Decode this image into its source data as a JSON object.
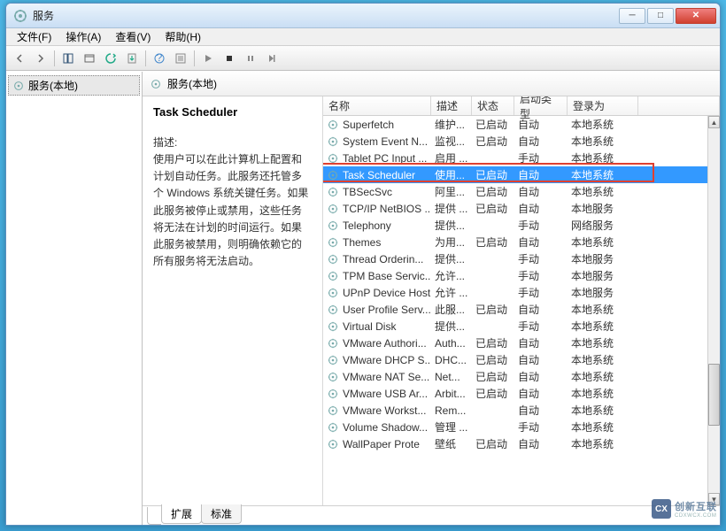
{
  "window": {
    "title": "服务"
  },
  "menu": {
    "file": "文件(F)",
    "action": "操作(A)",
    "view": "查看(V)",
    "help": "帮助(H)"
  },
  "tree": {
    "root": "服务(本地)"
  },
  "right_header": "服务(本地)",
  "detail": {
    "title": "Task Scheduler",
    "desc_label": "描述:",
    "desc": "使用户可以在此计算机上配置和计划自动任务。此服务还托管多个 Windows 系统关键任务。如果此服务被停止或禁用，这些任务将无法在计划的时间运行。如果此服务被禁用，则明确依赖它的所有服务将无法启动。"
  },
  "columns": {
    "name": "名称",
    "desc": "描述",
    "status": "状态",
    "startup": "启动类型",
    "logon": "登录为"
  },
  "services": [
    {
      "name": "Superfetch",
      "desc": "维护...",
      "status": "已启动",
      "startup": "自动",
      "logon": "本地系统"
    },
    {
      "name": "System Event N...",
      "desc": "监视...",
      "status": "已启动",
      "startup": "自动",
      "logon": "本地系统"
    },
    {
      "name": "Tablet PC Input ...",
      "desc": "启用 ...",
      "status": "",
      "startup": "手动",
      "logon": "本地系统"
    },
    {
      "name": "Task Scheduler",
      "desc": "使用...",
      "status": "已启动",
      "startup": "自动",
      "logon": "本地系统",
      "selected": true
    },
    {
      "name": "TBSecSvc",
      "desc": "阿里...",
      "status": "已启动",
      "startup": "自动",
      "logon": "本地系统"
    },
    {
      "name": "TCP/IP NetBIOS ...",
      "desc": "提供 ...",
      "status": "已启动",
      "startup": "自动",
      "logon": "本地服务"
    },
    {
      "name": "Telephony",
      "desc": "提供...",
      "status": "",
      "startup": "手动",
      "logon": "网络服务"
    },
    {
      "name": "Themes",
      "desc": "为用...",
      "status": "已启动",
      "startup": "自动",
      "logon": "本地系统"
    },
    {
      "name": "Thread Orderin...",
      "desc": "提供...",
      "status": "",
      "startup": "手动",
      "logon": "本地服务"
    },
    {
      "name": "TPM Base Servic...",
      "desc": "允许...",
      "status": "",
      "startup": "手动",
      "logon": "本地服务"
    },
    {
      "name": "UPnP Device Host",
      "desc": "允许 ...",
      "status": "",
      "startup": "手动",
      "logon": "本地服务"
    },
    {
      "name": "User Profile Serv...",
      "desc": "此服...",
      "status": "已启动",
      "startup": "自动",
      "logon": "本地系统"
    },
    {
      "name": "Virtual Disk",
      "desc": "提供...",
      "status": "",
      "startup": "手动",
      "logon": "本地系统"
    },
    {
      "name": "VMware Authori...",
      "desc": "Auth...",
      "status": "已启动",
      "startup": "自动",
      "logon": "本地系统"
    },
    {
      "name": "VMware DHCP S...",
      "desc": "DHC...",
      "status": "已启动",
      "startup": "自动",
      "logon": "本地系统"
    },
    {
      "name": "VMware NAT Se...",
      "desc": "Net...",
      "status": "已启动",
      "startup": "自动",
      "logon": "本地系统"
    },
    {
      "name": "VMware USB Ar...",
      "desc": "Arbit...",
      "status": "已启动",
      "startup": "自动",
      "logon": "本地系统"
    },
    {
      "name": "VMware Workst...",
      "desc": "Rem...",
      "status": "",
      "startup": "自动",
      "logon": "本地系统"
    },
    {
      "name": "Volume Shadow...",
      "desc": "管理 ...",
      "status": "",
      "startup": "手动",
      "logon": "本地系统"
    },
    {
      "name": "WallPaper Prote",
      "desc": "壁纸",
      "status": "已启动",
      "startup": "自动",
      "logon": "本地系统"
    }
  ],
  "tabs": {
    "extended": "扩展",
    "standard": "标准"
  },
  "watermark": {
    "logo": "CX",
    "text": "创新互联",
    "sub": "CDXWCX.COM"
  }
}
